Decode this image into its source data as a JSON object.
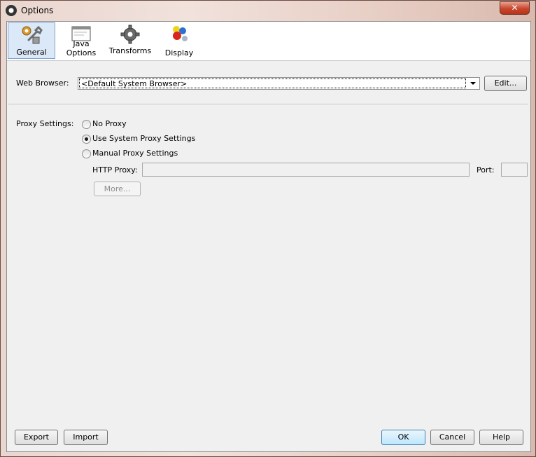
{
  "window": {
    "title": "Options",
    "close_label": "✕"
  },
  "toolbar": {
    "tabs": [
      {
        "label": "General",
        "selected": true,
        "icon": "wrench-gear-icon"
      },
      {
        "label": "Java Options",
        "selected": false,
        "icon": "window-icon"
      },
      {
        "label": "Transforms",
        "selected": false,
        "icon": "gear-icon"
      },
      {
        "label": "Display",
        "selected": false,
        "icon": "colored-shapes-icon"
      }
    ]
  },
  "web_browser": {
    "label": "Web Browser:",
    "value": "<Default System Browser>",
    "edit_label": "Edit..."
  },
  "proxy": {
    "label": "Proxy Settings:",
    "options": [
      {
        "label": "No Proxy",
        "selected": false
      },
      {
        "label": "Use System Proxy Settings",
        "selected": true
      },
      {
        "label": "Manual Proxy Settings",
        "selected": false
      }
    ],
    "http_proxy_label": "HTTP Proxy:",
    "http_proxy_value": "",
    "port_label": "Port:",
    "port_value": "",
    "more_label": "More..."
  },
  "footer": {
    "export_label": "Export",
    "import_label": "Import",
    "ok_label": "OK",
    "cancel_label": "Cancel",
    "help_label": "Help"
  },
  "colors": {
    "selected_tab": "#dbe8f8",
    "close_button": "#c8462c"
  }
}
